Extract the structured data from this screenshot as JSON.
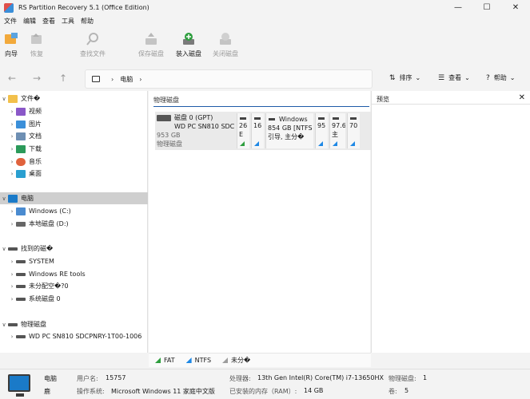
{
  "window": {
    "title": "RS Partition Recovery 5.1 (Office Edition)",
    "minimize": "—",
    "maximize": "☐",
    "close": "✕"
  },
  "menu": [
    "文件",
    "编辑",
    "查看",
    "工具",
    "帮助"
  ],
  "toolbar": {
    "wizard": "向导",
    "restore": "恢复",
    "find_file": "查找文件",
    "save_disk": "保存磁盘",
    "mount_disk": "装入磁盘",
    "close_disk": "关闭磁盘"
  },
  "nav": {
    "back": "←",
    "forward": "→",
    "up": "↑",
    "breadcrumb": "电脑",
    "sort": "排序",
    "view": "查看",
    "help": "帮助"
  },
  "tree": {
    "quick_access": {
      "label": "文件�",
      "items": [
        "视频",
        "图片",
        "文档",
        "下载",
        "音乐",
        "桌面"
      ]
    },
    "computer": {
      "label": "电脑",
      "items": [
        "Windows (C:)",
        "本地磁盘 (D:)"
      ]
    },
    "found_disks": {
      "label": "找到的磁�",
      "items": [
        "SYSTEM",
        "Windows RE tools",
        "未分配空�?0",
        "系统磁盘 0"
      ]
    },
    "physical": {
      "label": "物理磁盘",
      "items": [
        "WD PC SN810 SDCPNRY-1T00-1006"
      ]
    }
  },
  "center": {
    "header": "物理磁盘",
    "disk": {
      "name": "磁盘 0 (GPT)",
      "model": "WD PC SN810 SDC",
      "size": "953 GB",
      "type": "物理磁盘"
    },
    "partitions": [
      {
        "l1": "26",
        "l2": "E",
        "color": "#2e9e3e"
      },
      {
        "l1": "16",
        "l2": "",
        "color": "#1e88e5"
      },
      {
        "l1": "Windows",
        "l2": "854 GB [NTFS",
        "l3": "引导, 主分�",
        "color": "#1e88e5"
      },
      {
        "l1": "95",
        "l2": "",
        "color": "#1e88e5"
      },
      {
        "l1": "97.6",
        "l2": "主",
        "color": "#1e88e5"
      },
      {
        "l1": "70",
        "l2": "",
        "color": "#1e88e5"
      }
    ]
  },
  "preview": {
    "title": "预览",
    "close": "✕"
  },
  "legend": [
    {
      "label": "FAT",
      "color": "#2e9e3e"
    },
    {
      "label": "NTFS",
      "color": "#1e88e5"
    },
    {
      "label": "未分�",
      "color": "#9e9e9e"
    }
  ],
  "status": {
    "computer_name": "电脑",
    "computer_sub": "鹿",
    "user_label": "用户名:",
    "user_value": "15757",
    "os_label": "操作系统:",
    "os_value": "Microsoft Windows 11 家庭中文版",
    "cpu_label": "处理器:",
    "cpu_value": "13th Gen Intel(R) Core(TM) i7-13650HX",
    "ram_label": "已安装的内存（RAM）:",
    "ram_value": "14 GB",
    "disks_label": "物理磁盘:",
    "disks_value": "1",
    "volumes_label": "卷:",
    "volumes_value": "5"
  }
}
